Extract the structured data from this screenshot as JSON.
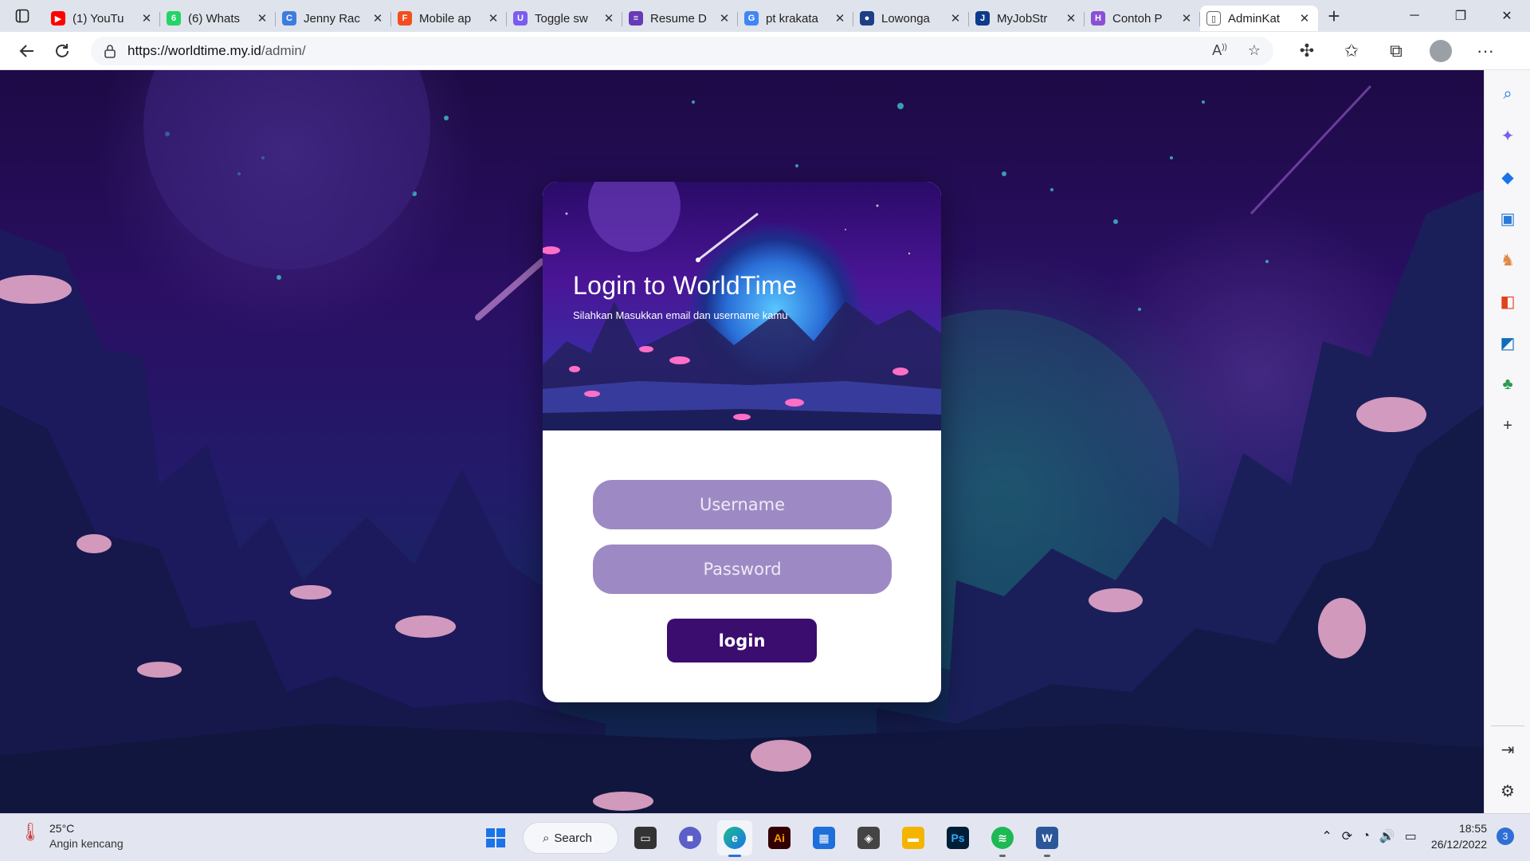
{
  "browser": {
    "tabs": [
      {
        "title": "(1) YouTu",
        "icon": "youtube-icon",
        "color": "#ff0000",
        "glyph": "▶"
      },
      {
        "title": "(6) Whats",
        "icon": "whatsapp-icon",
        "color": "#25d366",
        "glyph": "6"
      },
      {
        "title": "Jenny Rac",
        "icon": "canva-icon",
        "color": "#3d7de0",
        "glyph": "C"
      },
      {
        "title": "Mobile ap",
        "icon": "figma-icon",
        "color": "#f24e1e",
        "glyph": "F"
      },
      {
        "title": "Toggle sw",
        "icon": "uiverse-icon",
        "color": "#7b5cf0",
        "glyph": "U"
      },
      {
        "title": "Resume D",
        "icon": "forms-icon",
        "color": "#673ab7",
        "glyph": "≡"
      },
      {
        "title": "pt krakata",
        "icon": "google-icon",
        "color": "#4285f4",
        "glyph": "G"
      },
      {
        "title": "Lowonga",
        "icon": "globe-icon",
        "color": "#1c3f86",
        "glyph": "●"
      },
      {
        "title": "MyJobStr",
        "icon": "jobstreet-icon",
        "color": "#0d3a8c",
        "glyph": "J"
      },
      {
        "title": "Contoh P",
        "icon": "hashnode-icon",
        "color": "#8b4fd6",
        "glyph": "H"
      },
      {
        "title": "AdminKat",
        "icon": "page-icon",
        "color": "#ffffff",
        "glyph": "▯"
      }
    ],
    "url_host": "https://worldtime.my.id",
    "url_path": "/admin/"
  },
  "login": {
    "title": "Login to WorldTime",
    "subtitle": "Silahkan Masukkan email dan username kamu",
    "username_placeholder": "Username",
    "password_placeholder": "Password",
    "button_label": "login"
  },
  "taskbar": {
    "temperature": "25°C",
    "weather_text": "Angin kencang",
    "search_label": "Search",
    "time": "18:55",
    "date": "26/12/2022",
    "notification_count": "3"
  },
  "colors": {
    "field_bg": "#9d8ac4",
    "button_bg": "#3b0d6e",
    "taskbar_bg": "#e3e6f1"
  }
}
